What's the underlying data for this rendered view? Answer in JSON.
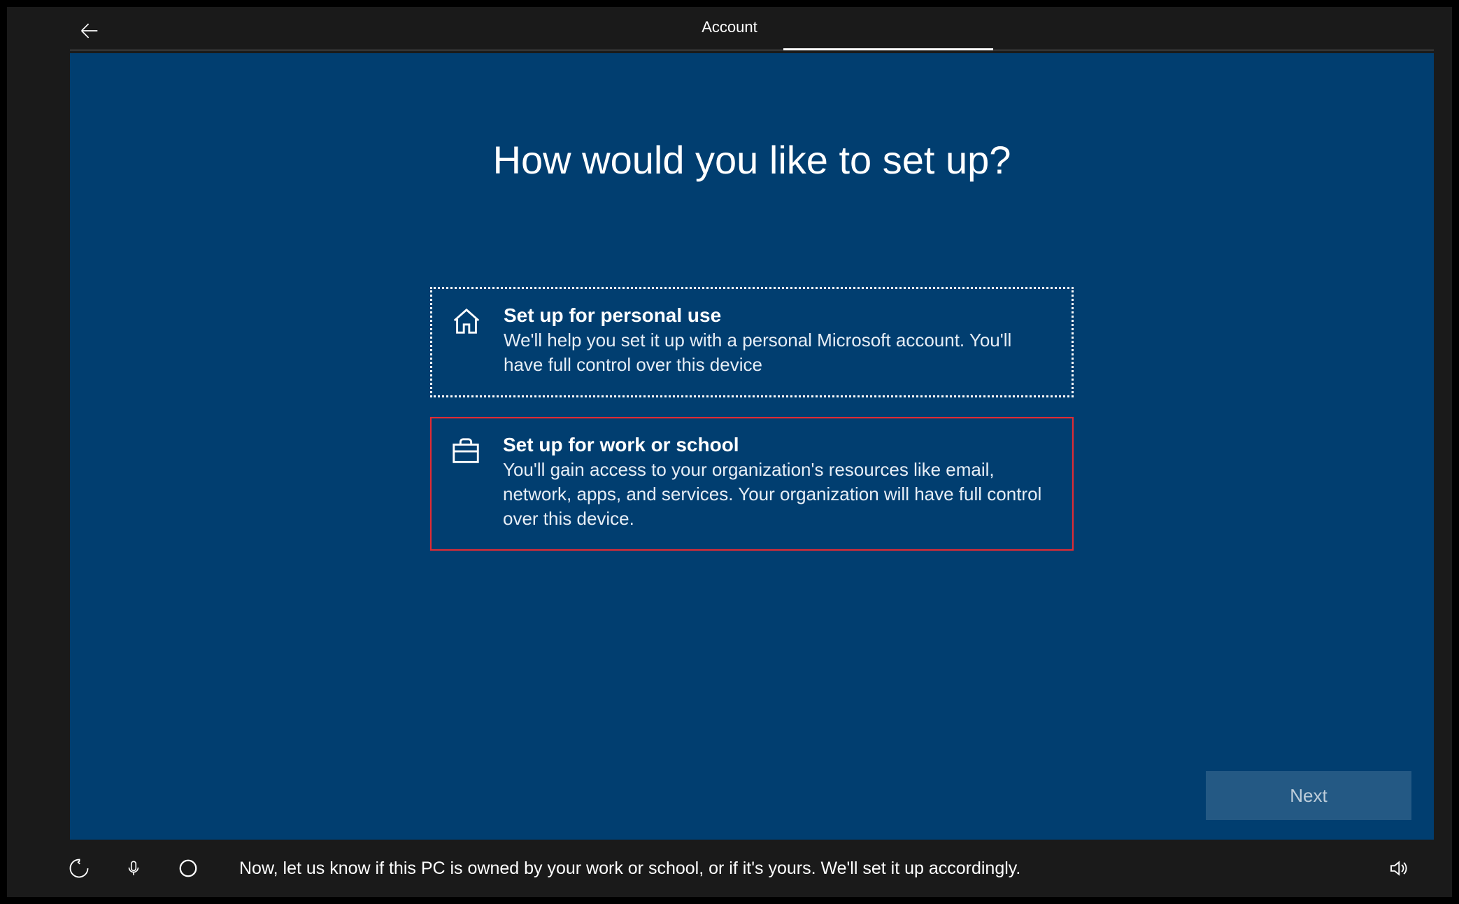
{
  "header": {
    "tab_title": "Account"
  },
  "main": {
    "title": "How would you like to set up?",
    "options": [
      {
        "heading": "Set up for personal use",
        "description": "We'll help you set it up with a personal Microsoft account. You'll have full control over this device"
      },
      {
        "heading": "Set up for work or school",
        "description": "You'll gain access to your organization's resources like email, network, apps, and services. Your organization will have full control over this device."
      }
    ],
    "next_label": "Next"
  },
  "bottom": {
    "cortana_text": "Now, let us know if this PC is owned by your work or school, or if it's yours. We'll set it up accordingly."
  }
}
